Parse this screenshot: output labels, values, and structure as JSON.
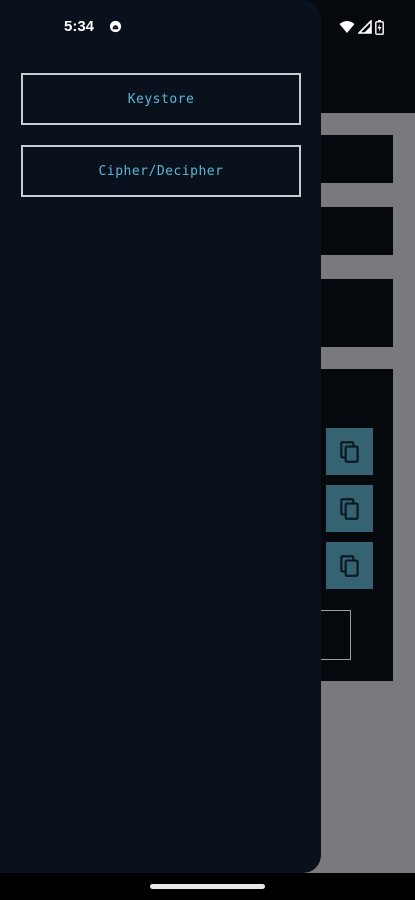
{
  "status_bar": {
    "time": "5:34",
    "notification_icon": "app-notification-icon",
    "wifi_icon": "wifi-icon",
    "signal_icon": "cell-signal-icon",
    "battery_icon": "battery-icon"
  },
  "drawer": {
    "items": [
      {
        "label": "Keystore"
      },
      {
        "label": "Cipher/Decipher"
      }
    ]
  },
  "background": {
    "copy_buttons": [
      {
        "icon": "copy-icon"
      },
      {
        "icon": "copy-icon"
      },
      {
        "icon": "copy-icon"
      }
    ]
  },
  "colors": {
    "drawer_bg": "#08111c",
    "accent_text": "#5fb6d6",
    "copy_button_bg": "#356372",
    "scrim": "#7a7a7e"
  }
}
